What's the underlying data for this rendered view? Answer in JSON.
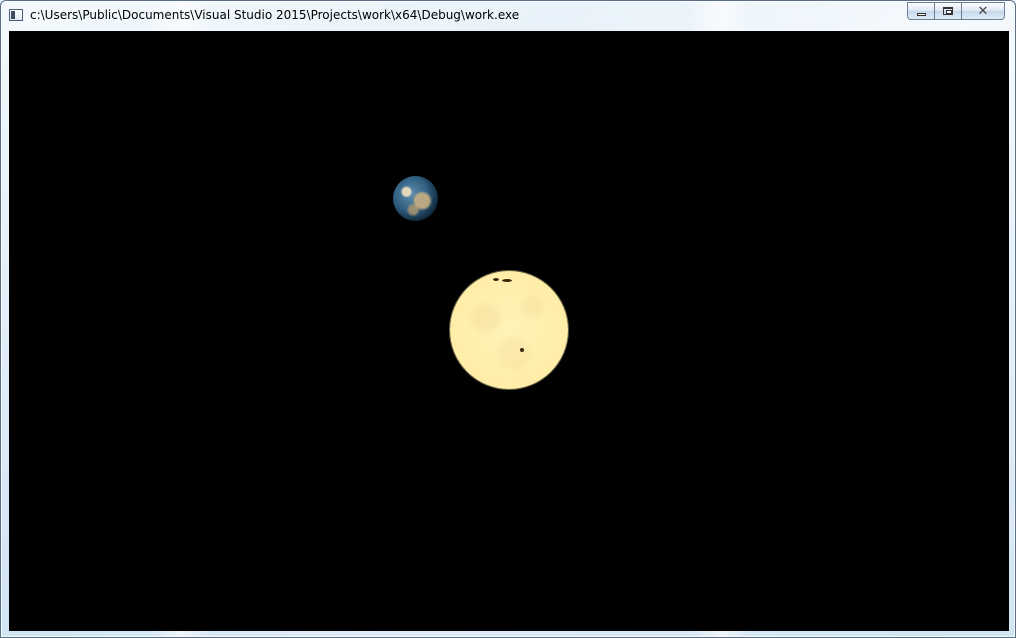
{
  "window": {
    "title": "c:\\Users\\Public\\Documents\\Visual Studio 2015\\Projects\\work\\x64\\Debug\\work.exe",
    "app_icon": "console-window-icon",
    "caption_buttons": {
      "minimize_icon": "minimize-icon",
      "maximize_icon": "maximize-icon",
      "close_icon": "close-icon",
      "close_glyph": "✕"
    }
  },
  "scene": {
    "background_color": "#000000",
    "objects": [
      {
        "name": "earth",
        "color": "#2e5d7e"
      },
      {
        "name": "sun",
        "color": "#ffeeaa"
      }
    ]
  }
}
